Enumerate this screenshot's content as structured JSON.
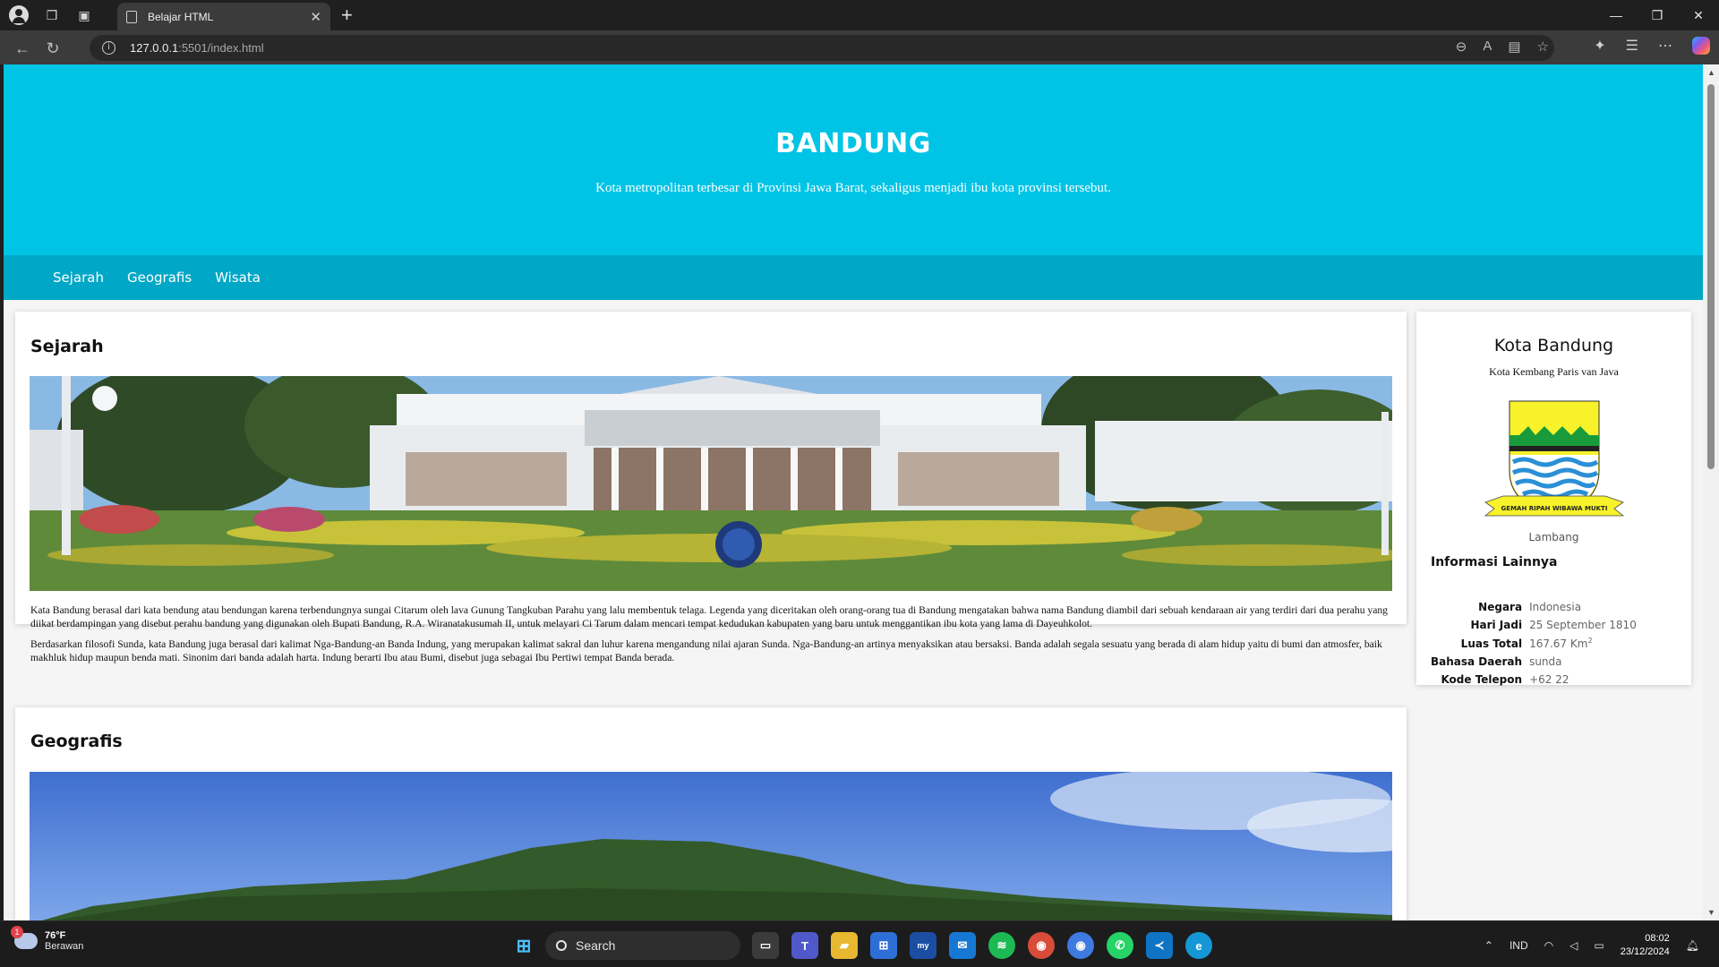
{
  "browser": {
    "tab_title": "Belajar HTML",
    "url_host": "127.0.0.1",
    "url_rest": ":5501/index.html"
  },
  "hero": {
    "title": "BANDUNG",
    "subtitle": "Kota metropolitan terbesar di Provinsi Jawa Barat, sekaligus menjadi ibu kota provinsi tersebut."
  },
  "nav": {
    "items": [
      "Sejarah",
      "Geografis",
      "Wisata"
    ]
  },
  "sejarah": {
    "heading": "Sejarah",
    "paragraphs": [
      "Kata Bandung berasal dari kata bendung atau bendungan karena terbendungnya sungai Citarum oleh lava Gunung Tangkuban Parahu yang lalu membentuk telaga. Legenda yang diceritakan oleh orang-orang tua di Bandung mengatakan bahwa nama Bandung diambil dari sebuah kendaraan air yang terdiri dari dua perahu yang diikat berdampingan yang disebut perahu bandung yang digunakan oleh Bupati Bandung, R.A. Wiranatakusumah II, untuk melayari Ci Tarum dalam mencari tempat kedudukan kabupaten yang baru untuk menggantikan ibu kota yang lama di Dayeuhkolot.",
      "Berdasarkan filosofi Sunda, kata Bandung juga berasal dari kalimat Nga-Bandung-an Banda Indung, yang merupakan kalimat sakral dan luhur karena mengandung nilai ajaran Sunda. Nga-Bandung-an artinya menyaksikan atau bersaksi. Banda adalah segala sesuatu yang berada di alam hidup yaitu di bumi dan atmosfer, baik makhluk hidup maupun benda mati. Sinonim dari banda adalah harta. Indung berarti Ibu atau Bumi, disebut juga sebagai Ibu Pertiwi tempat Banda berada."
    ]
  },
  "geografis": {
    "heading": "Geografis"
  },
  "aside": {
    "title": "Kota Bandung",
    "subtitle": "Kota Kembang Paris van Java",
    "emblem_caption": "Lambang",
    "emblem_motto": "GEMAH RIPAH WIBAWA MUKTI",
    "info_heading": "Informasi Lainnya",
    "info": [
      {
        "label": "Negara",
        "value": "Indonesia"
      },
      {
        "label": "Hari Jadi",
        "value": "25 September 1810"
      },
      {
        "label": "Luas Total",
        "value": "167.67 Km",
        "sup": "2"
      },
      {
        "label": "Bahasa Daerah",
        "value": "sunda"
      },
      {
        "label": "Kode Telepon",
        "value": "+62 22"
      }
    ]
  },
  "taskbar": {
    "temperature": "76°F",
    "condition": "Berawan",
    "weather_badge": "1",
    "search_label": "Search",
    "language": "IND",
    "time": "08:02",
    "date": "23/12/2024"
  },
  "colors": {
    "hero": "#00c4e6",
    "menubar": "#00a7c6"
  }
}
